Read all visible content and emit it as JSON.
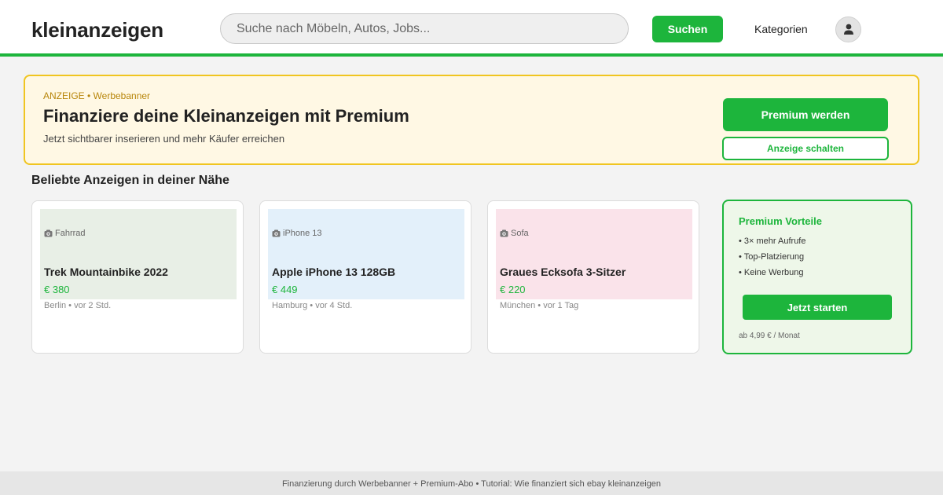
{
  "header": {
    "logo": "kleinanzeigen",
    "search_placeholder": "Suche nach Möbeln, Autos, Jobs...",
    "search_button": "Suchen",
    "categories_link": "Kategorien",
    "avatar_icon": "user-icon"
  },
  "banner": {
    "tag": "ANZEIGE • Werbebanner",
    "title": "Finanziere deine Kleinanzeigen mit Premium",
    "subtitle": "Jetzt sichtbarer inserieren und mehr Käufer erreichen",
    "primary_button": "Premium werden",
    "secondary_button": "Anzeige schalten",
    "background_color": "#fff8e4",
    "border_color": "#f0c520"
  },
  "listings": {
    "section_title": "Beliebte Anzeigen in deiner Nähe",
    "items": [
      {
        "category": "Fahrrad",
        "title": "Trek Mountainbike 2022",
        "price": "€ 380",
        "meta": "Berlin • vor 2 Std.",
        "image_color": "#e8efe6",
        "image_icon": "image-icon"
      },
      {
        "category": "iPhone 13",
        "title": "Apple iPhone 13 128GB",
        "price": "€ 449",
        "meta": "Hamburg • vor 4 Std.",
        "image_color": "#e3f0fa",
        "image_icon": "image-icon"
      },
      {
        "category": "Sofa",
        "title": "Graues Ecksofa 3-Sitzer",
        "price": "€ 220",
        "meta": "München • vor 1 Tag",
        "image_color": "#fae3ea",
        "image_icon": "image-icon"
      }
    ]
  },
  "promo": {
    "title": "Premium Vorteile",
    "benefits": [
      "• 3× mehr Aufrufe",
      "• Top-Platzierung",
      "• Keine Werbung"
    ],
    "button": "Jetzt starten",
    "note": "ab 4,99 € / Monat"
  },
  "footer": {
    "text": "Finanzierung durch Werbebanner + Premium-Abo • Tutorial: Wie finanziert sich ebay kleinanzeigen"
  },
  "colors": {
    "accent": "#1db53c",
    "page_background": "#f3f3f3"
  }
}
